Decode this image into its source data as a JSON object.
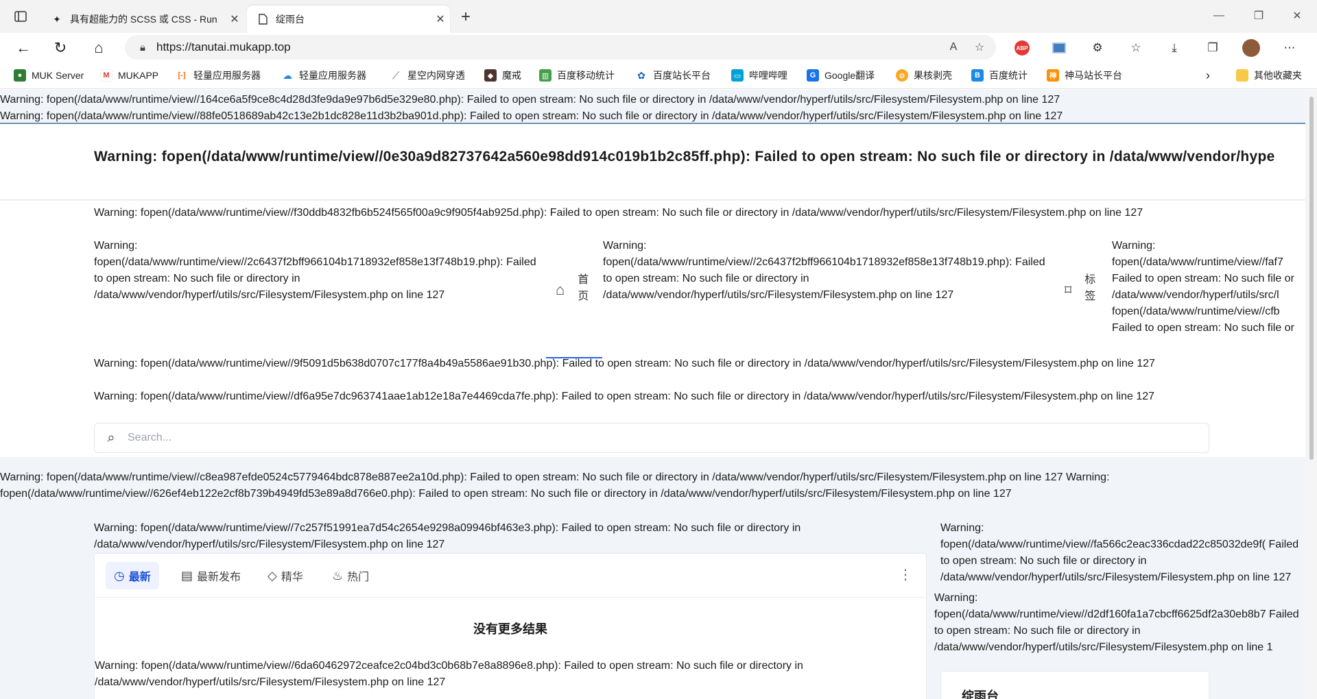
{
  "browser": {
    "tabs": [
      {
        "title": "具有超能力的 SCSS 或 CSS - Run",
        "icon": "codepen-icon"
      },
      {
        "title": "绽雨台",
        "icon": "page-icon"
      }
    ],
    "url": "https://tanutai.mukapp.top"
  },
  "bookmarks": [
    {
      "label": "MUK Server",
      "color": "#2e7d32"
    },
    {
      "label": "MUKAPP",
      "color": "#e53935"
    },
    {
      "label": "轻量应用服务器",
      "color": "#ff6a00"
    },
    {
      "label": "轻量应用服务器",
      "color": "#1e88e5"
    },
    {
      "label": "星空内网穿透",
      "color": "#9e9e9e"
    },
    {
      "label": "魔戒",
      "color": "#4e342e"
    },
    {
      "label": "百度移动统计",
      "color": "#43a047"
    },
    {
      "label": "百度站长平台",
      "color": "#1565c0"
    },
    {
      "label": "哔哩哔哩",
      "color": "#00a1d6"
    },
    {
      "label": "Google翻译",
      "color": "#1a73e8"
    },
    {
      "label": "果核剥壳",
      "color": "#f9a825"
    },
    {
      "label": "百度统计",
      "color": "#1e88e5"
    },
    {
      "label": "神马站长平台",
      "color": "#ff8f00"
    }
  ],
  "bookmarks_other": "其他收藏夹",
  "warnings": {
    "w1": "Warning: fopen(/data/www/runtime/view//164ce6a5f9ce8c4d28d3fe9da9e97b6d5e329e80.php): Failed to open stream: No such file or directory in /data/www/vendor/hyperf/utils/src/Filesystem/Filesystem.php on line 127",
    "w2": "Warning: fopen(/data/www/runtime/view//88fe0518689ab42c13e2b1dc828e11d3b2ba901d.php): Failed to open stream: No such file or directory in /data/www/vendor/hyperf/utils/src/Filesystem/Filesystem.php on line 127",
    "header": "Warning: fopen(/data/www/runtime/view//0e30a9d82737642a560e98dd914c019b1b2c85ff.php): Failed to open stream: No such file or directory in /data/www/vendor/hype",
    "w3": "Warning: fopen(/data/www/runtime/view//f30ddb4832fb6b524f565f00a9c9f905f4ab925d.php): Failed to open stream: No such file or directory in /data/www/vendor/hyperf/utils/src/Filesystem/Filesystem.php on line 127",
    "col1": "Warning: fopen(/data/www/runtime/view//2c6437f2bff966104b1718932ef858e13f748b19.php): Failed to open stream: No such file or directory in /data/www/vendor/hyperf/utils/src/Filesystem/Filesystem.php on line 127",
    "col2": "Warning: fopen(/data/www/runtime/view//2c6437f2bff966104b1718932ef858e13f748b19.php): Failed to open stream: No such file or directory in /data/www/vendor/hyperf/utils/src/Filesystem/Filesystem.php on line 127",
    "col3": "Warning: fopen(/data/www/runtime/view//faf7 Failed to open stream: No such file or /data/www/vendor/hyperf/utils/src/l fopen(/data/www/runtime/view//cfb Failed to open stream: No such file or /data/www/vendor/hyperf/utils/src/l",
    "w4": "Warning: fopen(/data/www/runtime/view//9f5091d5b638d0707c177f8a4b49a5586ae91b30.php): Failed to open stream: No such file or directory in /data/www/vendor/hyperf/utils/src/Filesystem/Filesystem.php on line 127",
    "w5": "Warning: fopen(/data/www/runtime/view//df6a95e7dc963741aae1ab12e18a7e4469cda7fe.php): Failed to open stream: No such file or directory in /data/www/vendor/hyperf/utils/src/Filesystem/Filesystem.php on line 127",
    "w6": "Warning: fopen(/data/www/runtime/view//c8ea987efde0524c5779464bdc878e887ee2a10d.php): Failed to open stream: No such file or directory in /data/www/vendor/hyperf/utils/src/Filesystem/Filesystem.php on line 127 Warning: fopen(/data/www/runtime/view//626ef4eb122e2cf8b739b4949fd53e89a8d766e0.php): Failed to open stream: No such file or directory in /data/www/vendor/hyperf/utils/src/Filesystem/Filesystem.php on line 127",
    "w7": "Warning: fopen(/data/www/runtime/view//7c257f51991ea7d54c2654e9298a09946bf463e3.php): Failed to open stream: No such file or directory in /data/www/vendor/hyperf/utils/src/Filesystem/Filesystem.php on line 127",
    "side1": "Warning: fopen(/data/www/runtime/view//fa566c2eac336cdad22c85032de9f( Failed to open stream: No such file or directory in /data/www/vendor/hyperf/utils/src/Filesystem/Filesystem.php on line 127",
    "side2": "Warning: fopen(/data/www/runtime/view//d2df160fa1a7cbcff6625df2a30eb8b7 Failed to open stream: No such file or directory in /data/www/vendor/hyperf/utils/src/Filesystem/Filesystem.php on line 1",
    "w8": "Warning: fopen(/data/www/runtime/view//6da60462972ceafce2c04bd3c0b68b7e8a8896e8.php): Failed to open stream: No such file or directory in /data/www/vendor/hyperf/utils/src/Filesystem/Filesystem.php on line 127"
  },
  "nav": {
    "home": "首页",
    "tags": "标签"
  },
  "search_placeholder": "Search...",
  "feed_tabs": [
    {
      "label": "最新",
      "icon": "clock-icon"
    },
    {
      "label": "最新发布",
      "icon": "document-icon"
    },
    {
      "label": "精华",
      "icon": "diamond-icon"
    },
    {
      "label": "热门",
      "icon": "flame-icon"
    }
  ],
  "no_more": "没有更多结果",
  "sidebar_card_title": "绽雨台"
}
